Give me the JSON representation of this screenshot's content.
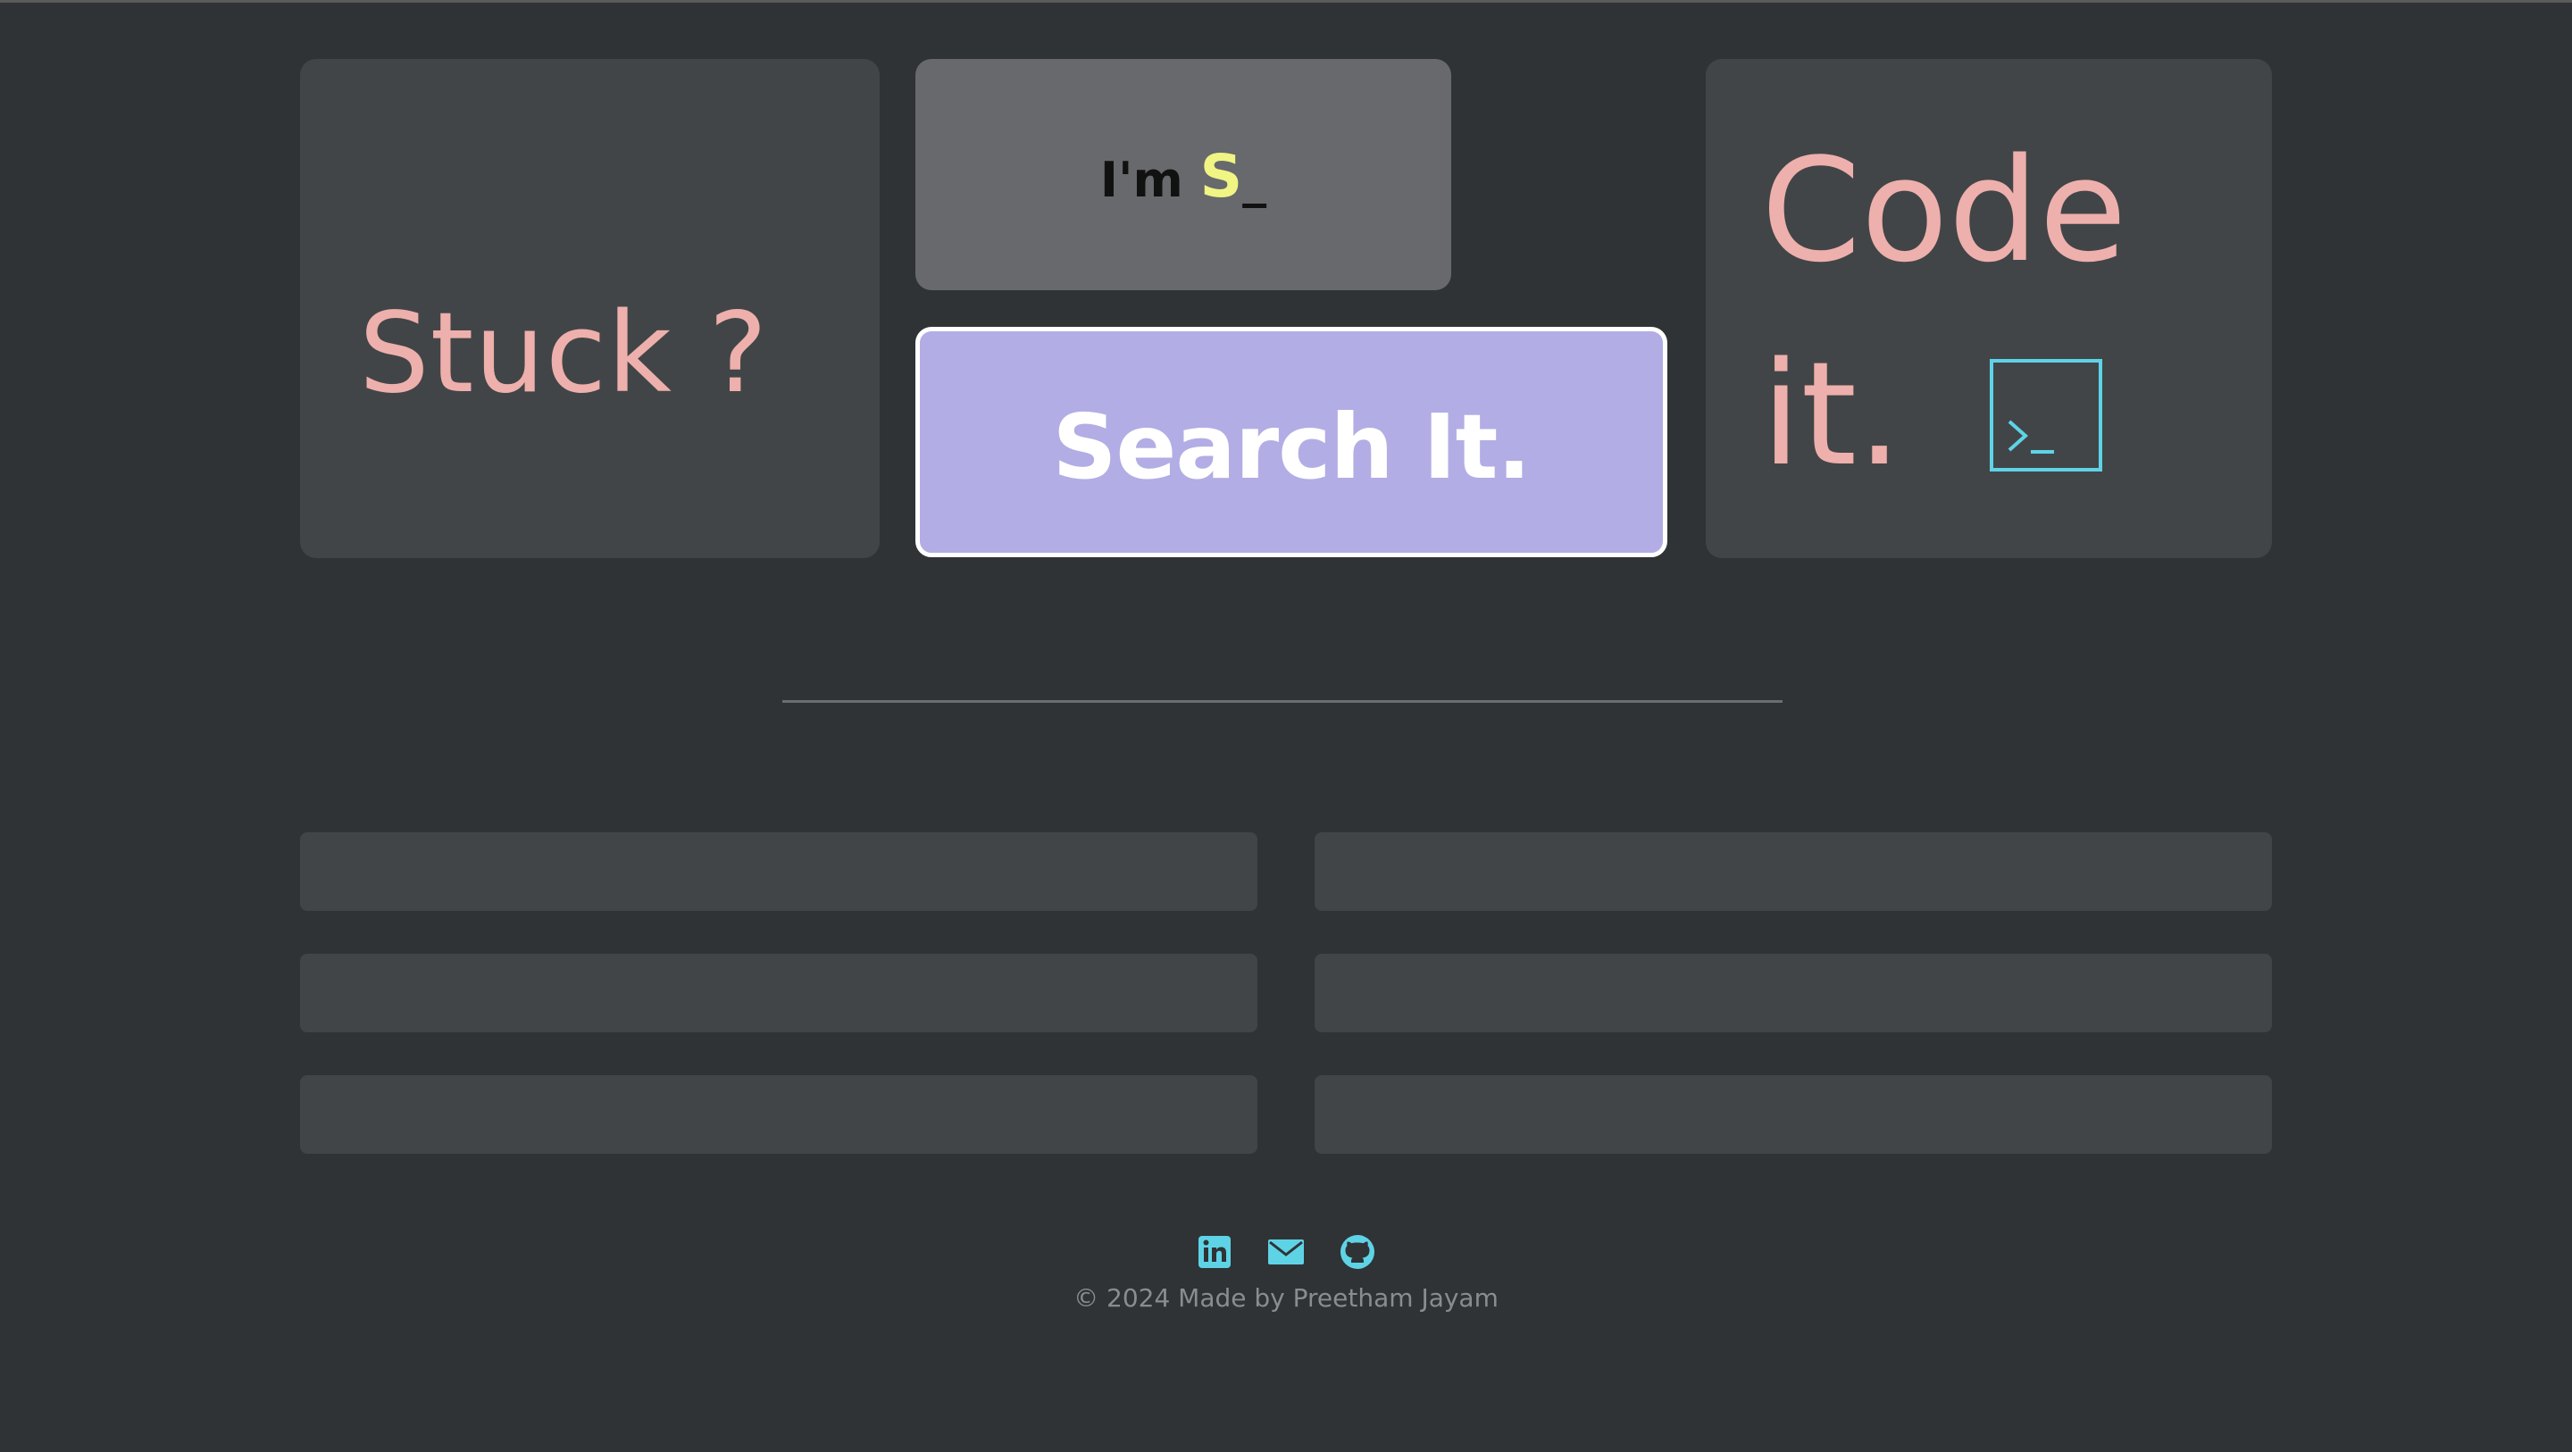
{
  "hero": {
    "stuck_text": "Stuck ?",
    "typing_prefix": "I'm",
    "typing_letter": "S",
    "typing_cursor": "_",
    "search_label": "Search It.",
    "code_word": "Code",
    "it_word": "it.",
    "terminal_icon": "terminal-icon"
  },
  "colors": {
    "background": "#2f3336",
    "card": "#424548",
    "accent_pink": "#eeb0ac",
    "accent_purple": "#b2ade4",
    "accent_yellow": "#f0f584",
    "accent_cyan": "#5fd3e6"
  },
  "footer": {
    "social": [
      {
        "icon": "linkedin-icon"
      },
      {
        "icon": "mail-icon"
      },
      {
        "icon": "github-icon"
      }
    ],
    "copyright": "© 2024 Made by Preetham Jayam"
  }
}
